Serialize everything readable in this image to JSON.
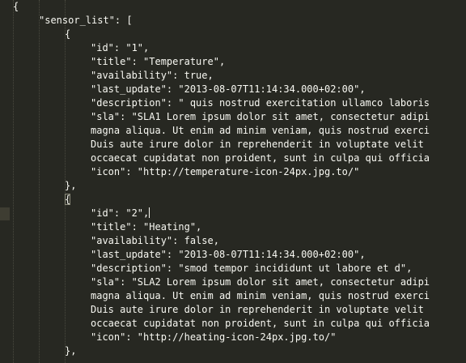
{
  "editor": {
    "lines": [
      "{",
      "\"sensor_list\": [",
      "{",
      "\"id\": \"1\",",
      "\"title\": \"Temperature\",",
      "\"availability\": true,",
      "\"last_update\": \"2013-08-07T11:14:34.000+02:00\",",
      "\"description\": \" quis nostrud exercitation ullamco laboris",
      "\"sla\": \"SLA1 Lorem ipsum dolor sit amet, consectetur adipi",
      "magna aliqua. Ut enim ad minim veniam, quis nostrud exerci",
      "Duis aute irure dolor in reprehenderit in voluptate velit",
      "occaecat cupidatat non proident, sunt in culpa qui officia",
      "\"icon\": \"http://temperature-icon-24px.jpg.to/\"",
      "},",
      "{",
      "\"id\": \"2\",",
      "\"title\": \"Heating\",",
      "\"availability\": false,",
      "\"last_update\": \"2013-08-07T11:14:34.000+02:00\",",
      "\"description\": \"smod tempor incididunt ut labore et d\",",
      "\"sla\": \"SLA2 Lorem ipsum dolor sit amet, consectetur adipi",
      "magna aliqua. Ut enim ad minim veniam, quis nostrud exerci",
      "Duis aute irure dolor in reprehenderit in voluptate velit",
      "occaecat cupidatat non proident, sunt in culpa qui officia",
      "\"icon\": \"http://heating-icon-24px.jpg.to/\"",
      "},"
    ]
  },
  "colors": {
    "background": "#272822",
    "text": "#f8f8f2",
    "active_line_gutter": "#3e3d32",
    "indent_guide": "#4a4a40"
  }
}
